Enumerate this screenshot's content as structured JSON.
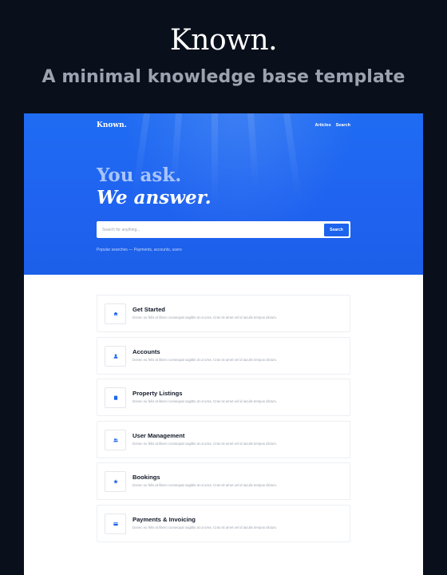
{
  "promo": {
    "title": "Known.",
    "subtitle": "A minimal knowledge base template"
  },
  "nav": {
    "brand": "Known.",
    "links": [
      "Articles",
      "Search"
    ]
  },
  "hero": {
    "headline_line1": "You ask.",
    "headline_line2": "We answer."
  },
  "search": {
    "placeholder": "Search for anything...",
    "button_label": "Search"
  },
  "popular": {
    "text": "Popular searches — Payments, accounts, users"
  },
  "colors": {
    "accent": "#1d63ed",
    "background_dark": "#0a0f1c"
  },
  "categories": [
    {
      "title": "Get Started",
      "icon": "home-icon",
      "description": "Donec eu felis at libero consequat sagittis at ut urna. Cras sit amet vel id iaculis tempus dictum."
    },
    {
      "title": "Accounts",
      "icon": "user-icon",
      "description": "Donec eu felis at libero consequat sagittis at ut urna. Cras sit amet vel id iaculis tempus dictum."
    },
    {
      "title": "Property Listings",
      "icon": "building-icon",
      "description": "Donec eu felis at libero consequat sagittis at ut urna. Cras sit amet vel id iaculis tempus dictum."
    },
    {
      "title": "User Management",
      "icon": "users-icon",
      "description": "Donec eu felis at libero consequat sagittis at ut urna. Cras sit amet vel id iaculis tempus dictum."
    },
    {
      "title": "Bookings",
      "icon": "star-icon",
      "description": "Donec eu felis at libero consequat sagittis at ut urna. Cras sit amet vel id iaculis tempus dictum."
    },
    {
      "title": "Payments & Invoicing",
      "icon": "credit-card-icon",
      "description": "Donec eu felis at libero consequat sagittis at ut urna. Cras sit amet vel id iaculis tempus dictum."
    }
  ]
}
